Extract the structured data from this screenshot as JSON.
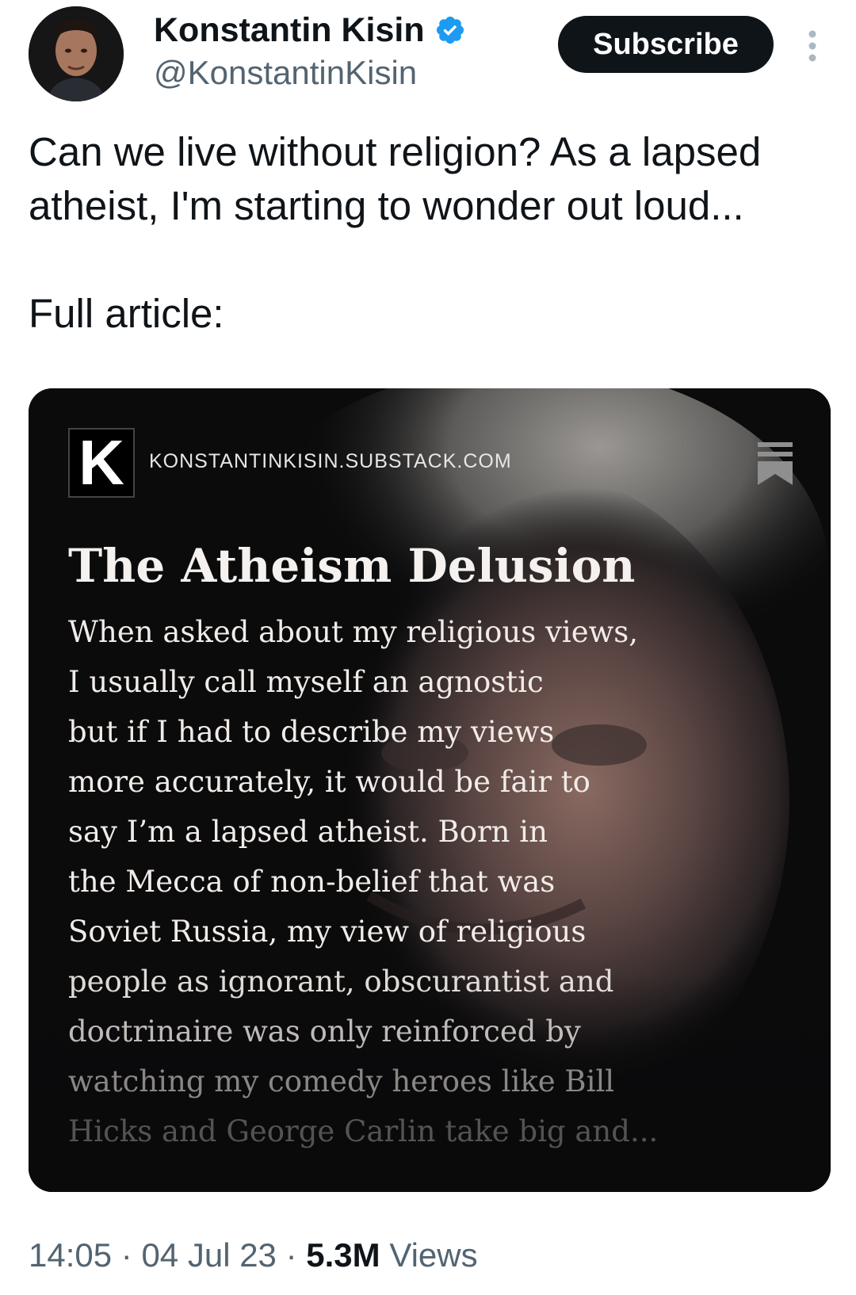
{
  "author": {
    "name": "Konstantin Kisin",
    "handle": "@KonstantinKisin",
    "verified": true
  },
  "subscribe_button": {
    "label": "Subscribe"
  },
  "tweet": {
    "text_paragraphs": [
      "Can we live without religion? As a lapsed atheist, I'm starting to wonder out loud...",
      "Full article:"
    ]
  },
  "link_card": {
    "logo_letter": "K",
    "domain": "KONSTANTINKISIN.SUBSTACK.COM",
    "title": "The Atheism Delusion",
    "excerpt_lines": [
      "When asked about my religious views,",
      "I usually call myself an agnostic",
      "but if I had to describe my views",
      "more accurately, it would be fair to",
      "say I’m a lapsed atheist. Born in",
      "the Mecca of non-belief that was",
      "Soviet Russia, my view of religious",
      "people as ignorant, obscurantist and",
      "doctrinaire was only reinforced by",
      "watching my comedy heroes like Bill",
      "Hicks and George Carlin take big and..."
    ]
  },
  "meta": {
    "time": "14:05",
    "separator": "·",
    "date": "04 Jul 23",
    "views_count": "5.3M",
    "views_label": "Views"
  },
  "colors": {
    "verified_badge": "#1d9bf0",
    "secondary_text": "#536471",
    "primary_text": "#0f1419",
    "subscribe_bg": "#0f1419"
  },
  "icons": {
    "verified": "verified-badge-icon",
    "more": "more-vertical-icon",
    "bookmark": "bookmark-icon"
  }
}
